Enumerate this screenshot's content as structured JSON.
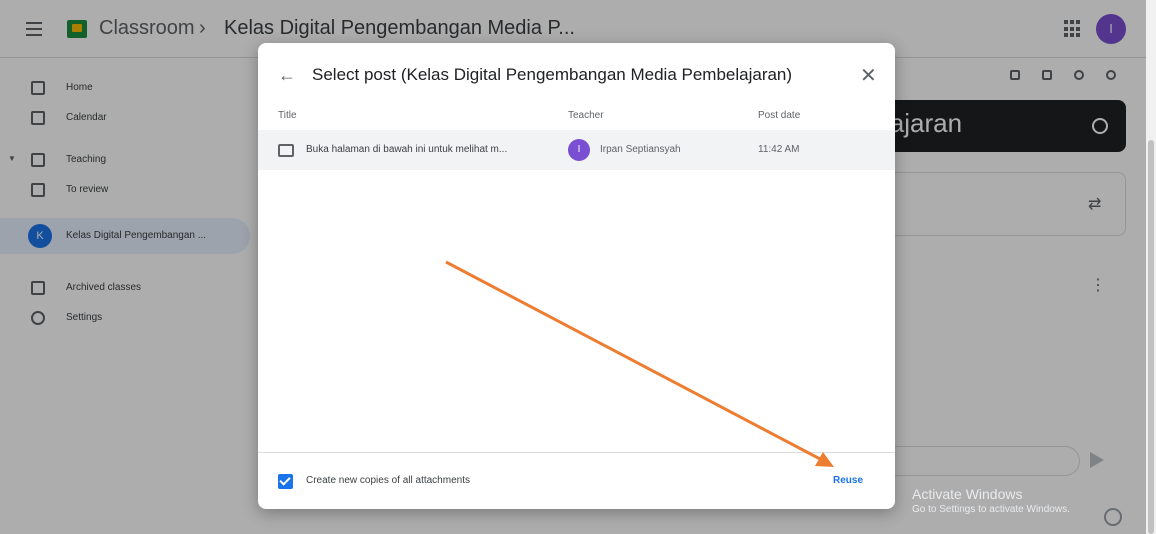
{
  "colors": {
    "accent": "#1a73e8",
    "annotation_arrow": "#ed7d31",
    "teacher_avatar": "#7b4fd1"
  },
  "header": {
    "app_name": "Classroom",
    "separator": "›",
    "class_name": "Kelas Digital Pengembangan Media P...",
    "apps_icon": "apps-grid-icon",
    "user_avatar_initial": "I"
  },
  "sidebar": {
    "items": [
      {
        "label": "Home",
        "icon": "home-icon"
      },
      {
        "label": "Calendar",
        "icon": "calendar-icon"
      },
      {
        "label": "Teaching",
        "icon": "people-icon"
      },
      {
        "label": "To review",
        "icon": "inbox-icon"
      },
      {
        "label": "Kelas Digital Pengembangan ...",
        "icon": "class-avatar",
        "initial": "K"
      },
      {
        "label": "Archived classes",
        "icon": "archive-icon"
      },
      {
        "label": "Settings",
        "icon": "gear-icon"
      }
    ]
  },
  "background": {
    "banner_text": "lajaran",
    "activate_windows_title": "Activate Windows",
    "activate_windows_sub": "Go to Settings to activate Windows."
  },
  "dialog": {
    "title": "Select post (Kelas Digital Pengembangan Media Pembelajaran)",
    "back_icon": "arrow-back-icon",
    "close_icon": "close-icon",
    "columns": {
      "title": "Title",
      "teacher": "Teacher",
      "post_date": "Post date"
    },
    "rows": [
      {
        "title": "Buka halaman di bawah ini untuk melihat m...",
        "teacher_initial": "I",
        "teacher": "Irpan Septiansyah",
        "post_date": "11:42 AM"
      }
    ],
    "copy_attachments_label": "Create new copies of all attachments",
    "copy_attachments_checked": true,
    "reuse_label": "Reuse"
  }
}
